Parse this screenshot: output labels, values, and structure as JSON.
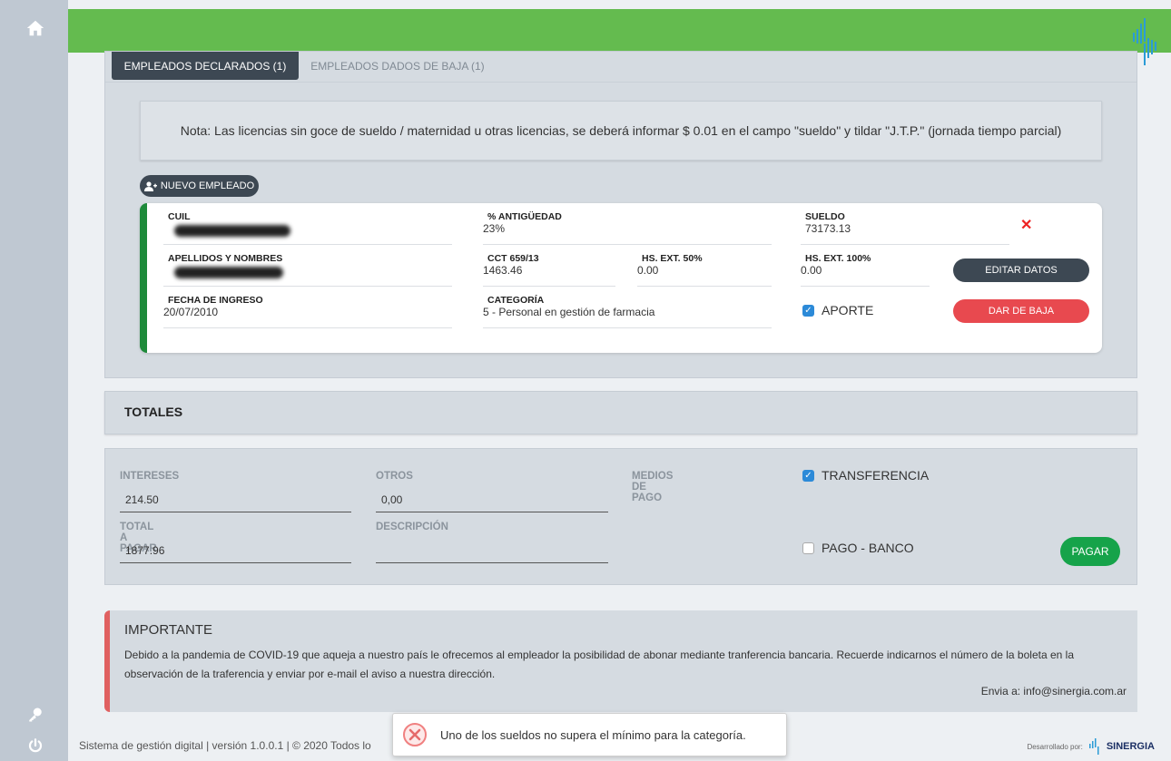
{
  "tabs": [
    {
      "label": "EMPLEADOS DECLARADOS (1)"
    },
    {
      "label": "EMPLEADOS DADOS DE BAJA (1)"
    }
  ],
  "note": "Nota: Las licencias sin goce de sueldo / maternidad u otras licencias, se deberá informar $ 0.01 en el campo \"sueldo\" y tildar \"J.T.P.\" (jornada tiempo parcial)",
  "new_employee_label": "NUEVO EMPLEADO",
  "employee": {
    "cuil": {
      "label": "CUIL",
      "value": ""
    },
    "antiguedad": {
      "label": "% ANTIGÜEDAD",
      "value": "23%"
    },
    "sueldo": {
      "label": "SUELDO",
      "value": "73173.13"
    },
    "nombres": {
      "label": "APELLIDOS Y NOMBRES",
      "value": ""
    },
    "cct": {
      "label": "CCT 659/13",
      "value": "1463.46"
    },
    "hs50": {
      "label": "HS. EXT. 50%",
      "value": "0.00"
    },
    "hs100": {
      "label": "HS. EXT. 100%",
      "value": "0.00"
    },
    "ingreso": {
      "label": "FECHA DE INGRESO",
      "value": "20/07/2010"
    },
    "categoria": {
      "label": "CATEGORÍA",
      "value": "5 - Personal en gestión de farmacia"
    },
    "aporte_label": "APORTE",
    "aporte_checked": true,
    "edit_label": "EDITAR DATOS",
    "drop_label": "DAR DE BAJA"
  },
  "totals": {
    "title": "TOTALES",
    "intereses": {
      "label": "INTERESES",
      "value": "214.50"
    },
    "otros": {
      "label": "OTROS",
      "value": "0,00"
    },
    "total": {
      "label": "TOTAL A PAGAR",
      "value": "1877.96"
    },
    "descripcion": {
      "label": "DESCRIPCIÓN",
      "value": ""
    },
    "medios_label": "MEDIOS DE PAGO",
    "transferencia_label": "TRANSFERENCIA",
    "transferencia_checked": true,
    "banco_label": "PAGO - BANCO",
    "banco_checked": false,
    "pay_label": "PAGAR"
  },
  "important": {
    "title": "IMPORTANTE",
    "text": "Debido a la pandemia de COVID-19 que aqueja a nuestro país le ofrecemos al empleador la posibilidad de abonar mediante tranferencia bancaria. Recuerde indicarnos el número de la boleta en la observación de la traferencia y enviar por e-mail el aviso a nuestra dirección.",
    "mail": "Envia a: info@sinergia.com.ar"
  },
  "footer": {
    "text": "Sistema de gestión digital | versión 1.0.0.1 | © 2020 Todos lo",
    "dev_label": "Desarrollado por:",
    "brand": "SINERGIA"
  },
  "toast": "Uno de los sueldos no supera el mínimo para la categoría.",
  "colors": {
    "topbar": "#64bb4f",
    "sidebar": "#bfc8d2",
    "panel": "#d5dbe1",
    "dark": "#3d4853",
    "danger": "#e8494f",
    "success": "#16a34a",
    "card_accent": "#1e8a3a",
    "checkbox": "#2c8ad8"
  },
  "icons": [
    "home-icon",
    "key-icon",
    "power-icon",
    "user-plus-icon",
    "close-icon",
    "error-icon",
    "brand-logo-icon"
  ]
}
